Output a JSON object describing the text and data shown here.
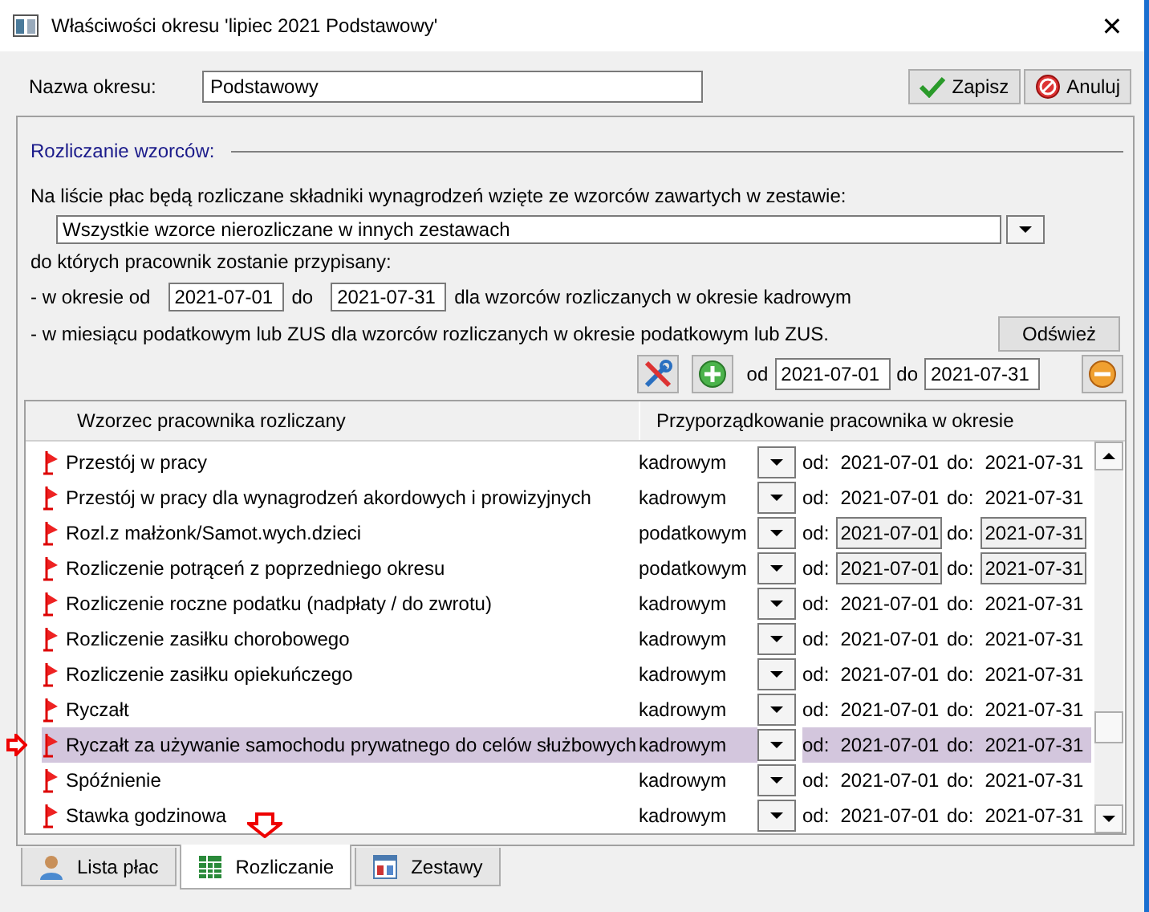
{
  "window": {
    "title": "Właściwości okresu 'lipiec 2021 Podstawowy'",
    "close": "✕"
  },
  "name_field": {
    "label": "Nazwa okresu:",
    "value": "Podstawowy"
  },
  "buttons": [
    {
      "label": "Zapisz",
      "kind": "save"
    },
    {
      "label": "Anuluj",
      "kind": "cancel"
    }
  ],
  "group": {
    "title": "Rozliczanie wzorców:",
    "intro": "Na liście płac będą rozliczane składniki wynagrodzeń wzięte ze wzorców zawartych w zestawie:",
    "set_select": {
      "value": "Wszystkie wzorce nierozliczane w innych zestawach"
    },
    "assigned_text": "do których pracownik zostanie przypisany:",
    "period_line": {
      "prefix": "- w okresie od",
      "from": "2021-07-01",
      "mid": "do",
      "to": "2021-07-31",
      "suffix": "dla wzorców rozliczanych w okresie kadrowym"
    },
    "tax_line": "- w miesiącu podatkowym lub ZUS dla wzorców rozliczanych w okresie podatkowym lub ZUS.",
    "refresh_button": "Odśwież",
    "toolbar": {
      "from_label": "od",
      "from": "2021-07-01",
      "to_label": "do",
      "to": "2021-07-31"
    }
  },
  "table": {
    "columns": [
      "Wzorzec pracownika rozliczany",
      "Przyporządkowanie pracownika w okresie"
    ],
    "rows": [
      {
        "name": "Przestój w pracy",
        "period": "kadrowym",
        "od_label": "od:",
        "od": "2021-07-01",
        "do_label": "do:",
        "do": "2021-07-31",
        "boxed": false,
        "selected": false
      },
      {
        "name": "Przestój w pracy dla wynagrodzeń akordowych i prowizyjnych",
        "period": "kadrowym",
        "od_label": "od:",
        "od": "2021-07-01",
        "do_label": "do:",
        "do": "2021-07-31",
        "boxed": false,
        "selected": false
      },
      {
        "name": "Rozl.z małżonk/Samot.wych.dzieci",
        "period": "podatkowym",
        "od_label": "od:",
        "od": "2021-07-01",
        "do_label": "do:",
        "do": "2021-07-31",
        "boxed": true,
        "selected": false
      },
      {
        "name": "Rozliczenie potrąceń z poprzedniego okresu",
        "period": "podatkowym",
        "od_label": "od:",
        "od": "2021-07-01",
        "do_label": "do:",
        "do": "2021-07-31",
        "boxed": true,
        "selected": false
      },
      {
        "name": "Rozliczenie roczne podatku (nadpłaty / do zwrotu)",
        "period": "kadrowym",
        "od_label": "od:",
        "od": "2021-07-01",
        "do_label": "do:",
        "do": "2021-07-31",
        "boxed": false,
        "selected": false
      },
      {
        "name": "Rozliczenie zasiłku chorobowego",
        "period": "kadrowym",
        "od_label": "od:",
        "od": "2021-07-01",
        "do_label": "do:",
        "do": "2021-07-31",
        "boxed": false,
        "selected": false
      },
      {
        "name": "Rozliczenie zasiłku opiekuńczego",
        "period": "kadrowym",
        "od_label": "od:",
        "od": "2021-07-01",
        "do_label": "do:",
        "do": "2021-07-31",
        "boxed": false,
        "selected": false
      },
      {
        "name": "Ryczałt",
        "period": "kadrowym",
        "od_label": "od:",
        "od": "2021-07-01",
        "do_label": "do:",
        "do": "2021-07-31",
        "boxed": false,
        "selected": false
      },
      {
        "name": "Ryczałt za używanie samochodu prywatnego do celów służbowych",
        "period": "kadrowym",
        "od_label": "od:",
        "od": "2021-07-01",
        "do_label": "do:",
        "do": "2021-07-31",
        "boxed": false,
        "selected": true
      },
      {
        "name": "Spóźnienie",
        "period": "kadrowym",
        "od_label": "od:",
        "od": "2021-07-01",
        "do_label": "do:",
        "do": "2021-07-31",
        "boxed": false,
        "selected": false
      },
      {
        "name": "Stawka godzinowa",
        "period": "kadrowym",
        "od_label": "od:",
        "od": "2021-07-01",
        "do_label": "do:",
        "do": "2021-07-31",
        "boxed": false,
        "selected": false
      }
    ]
  },
  "tabs": [
    {
      "label": "Lista płac",
      "kind": "person",
      "selected": false
    },
    {
      "label": "Rozliczanie",
      "kind": "calc",
      "selected": true
    },
    {
      "label": "Zestawy",
      "kind": "set",
      "selected": false
    }
  ]
}
